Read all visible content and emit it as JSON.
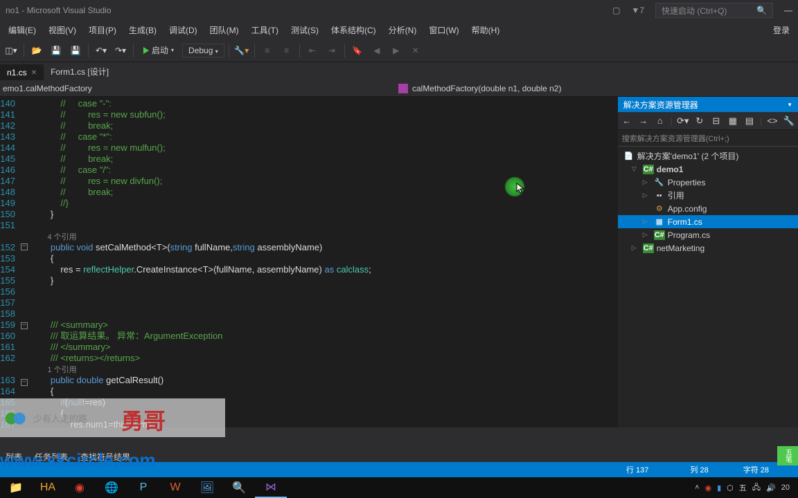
{
  "title_bar": {
    "title": "no1 - Microsoft Visual Studio",
    "search_placeholder": "快速启动 (Ctrl+Q)",
    "filter_count": "7"
  },
  "menu": [
    "编辑(E)",
    "视图(V)",
    "项目(P)",
    "生成(B)",
    "调试(D)",
    "团队(M)",
    "工具(T)",
    "测试(S)",
    "体系结构(C)",
    "分析(N)",
    "窗口(W)",
    "帮助(H)"
  ],
  "menu_right": "登录",
  "toolbar": {
    "start": "启动",
    "config": "Debug"
  },
  "tabs": [
    {
      "label": "n1.cs",
      "active": true
    },
    {
      "label": "Form1.cs [设计]",
      "active": false
    }
  ],
  "nav": {
    "left": "emo1.calMethodFactory",
    "right": "calMethodFactory(double n1, double n2)"
  },
  "line_numbers": [
    "140",
    "141",
    "142",
    "143",
    "144",
    "145",
    "146",
    "147",
    "148",
    "149",
    "150",
    "151",
    "",
    "152",
    "153",
    "154",
    "155",
    "156",
    "157",
    "158",
    "159",
    "160",
    "161",
    "162",
    "",
    "163",
    "164",
    "165",
    "166",
    "167"
  ],
  "code_lines": [
    {
      "t": "            //     case \"-\":",
      "c": "cmt"
    },
    {
      "t": "            //         res = new subfun();",
      "c": "cmt"
    },
    {
      "t": "            //         break;",
      "c": "cmt"
    },
    {
      "t": "            //     case \"*\":",
      "c": "cmt"
    },
    {
      "t": "            //         res = new mulfun();",
      "c": "cmt"
    },
    {
      "t": "            //         break;",
      "c": "cmt"
    },
    {
      "t": "            //     case \"/\":",
      "c": "cmt"
    },
    {
      "t": "            //         res = new divfun();",
      "c": "cmt"
    },
    {
      "t": "            //         break;",
      "c": "cmt"
    },
    {
      "t": "            //}",
      "c": "cmt"
    },
    {
      "t": "        }",
      "c": "id"
    },
    {
      "t": "",
      "c": ""
    },
    {
      "t": "        4 个引用",
      "c": "ref"
    },
    {
      "html": "        <span class='kw'>public</span> <span class='kw'>void</span> <span class='id'>setCalMethod&lt;T&gt;(</span><span class='kw'>string</span> <span class='id'>fullName,</span><span class='kw'>string</span> <span class='id'>assemblyName)</span>"
    },
    {
      "t": "        {",
      "c": "id"
    },
    {
      "html": "            <span class='id'>res = </span><span class='type'>reflectHelper</span><span class='id'>.CreateInstance&lt;T&gt;(fullName, assemblyName) </span><span class='kw'>as</span> <span class='type'>calclass</span><span class='id'>;</span>"
    },
    {
      "t": "        }",
      "c": "id"
    },
    {
      "t": "",
      "c": ""
    },
    {
      "t": "",
      "c": ""
    },
    {
      "t": "",
      "c": ""
    },
    {
      "html": "        <span class='cmt'>/// &lt;summary&gt;</span>"
    },
    {
      "html": "        <span class='cmt'>/// 取运算结果。 异常：ArgumentException</span>"
    },
    {
      "html": "        <span class='cmt'>/// &lt;/summary&gt;</span>"
    },
    {
      "html": "        <span class='cmt'>/// &lt;returns&gt;&lt;/returns&gt;</span>"
    },
    {
      "t": "        1 个引用",
      "c": "ref"
    },
    {
      "html": "        <span class='kw'>public</span> <span class='kw'>double</span> <span class='id'>getCalResult()</span>"
    },
    {
      "t": "        {",
      "c": "id"
    },
    {
      "html": "            <span class='kw'>if</span><span class='id'>(</span><span class='kw'>null</span><span class='id'>!=res)</span>"
    },
    {
      "t": "            {",
      "c": "id"
    },
    {
      "html": "                <span class='id'>res.num1=this.num1;</span>"
    }
  ],
  "solution": {
    "header": "解决方案资源管理器",
    "search_placeholder": "搜索解决方案资源管理器(Ctrl+;)",
    "root": "解决方案'demo1' (2 个项目)",
    "proj1": "demo1",
    "items1": [
      "Properties",
      "引用",
      "App.config",
      "Form1.cs",
      "Program.cs"
    ],
    "proj2": "netMarketing"
  },
  "bottom_tabs": [
    "列表",
    "任务列表",
    "查找符号结果"
  ],
  "status": {
    "line": "行 137",
    "col": "列 28",
    "char": "字符 28",
    "badge": "五笔"
  },
  "watermark": {
    "small": "少有人走的路",
    "big": "勇哥",
    "url": "www.skcircle.com"
  },
  "taskbar_time": "20"
}
